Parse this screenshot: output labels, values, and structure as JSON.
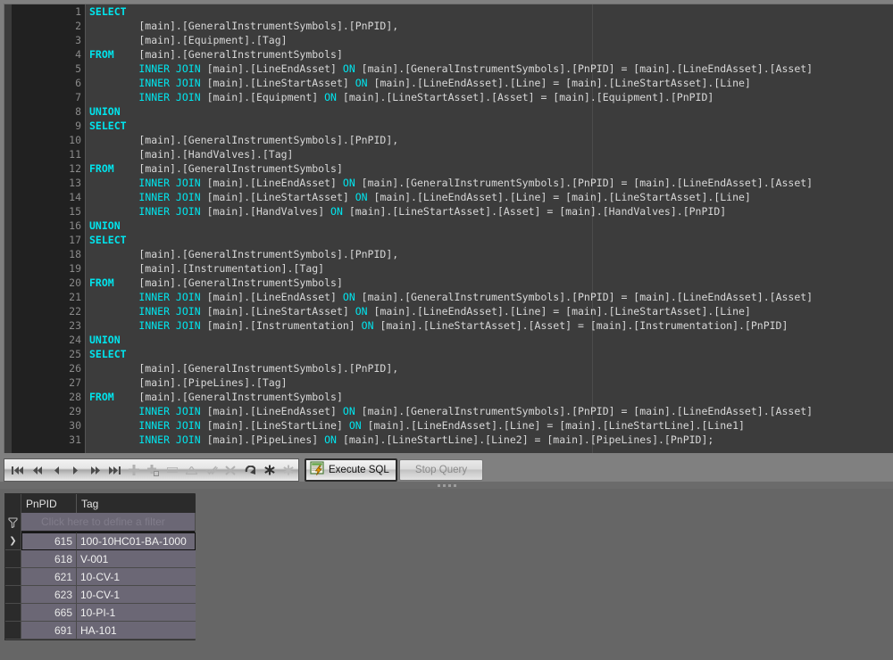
{
  "editor": {
    "name": "sql-editor",
    "lines": [
      {
        "n": "1",
        "segments": [
          {
            "t": "SELECT",
            "c": "kw"
          }
        ]
      },
      {
        "n": "2",
        "segments": [
          {
            "t": "        [main].[GeneralInstrumentSymbols].[PnPID],",
            "c": "pl"
          }
        ]
      },
      {
        "n": "3",
        "segments": [
          {
            "t": "        [main].[Equipment].[Tag]",
            "c": "pl"
          }
        ]
      },
      {
        "n": "4",
        "segments": [
          {
            "t": "FROM",
            "c": "kw"
          },
          {
            "t": "    [main].[GeneralInstrumentSymbols]",
            "c": "pl"
          }
        ]
      },
      {
        "n": "5",
        "segments": [
          {
            "t": "        ",
            "c": "pl"
          },
          {
            "t": "INNER JOIN",
            "c": "kw2"
          },
          {
            "t": " [main].[LineEndAsset] ",
            "c": "pl"
          },
          {
            "t": "ON",
            "c": "kw2"
          },
          {
            "t": " [main].[GeneralInstrumentSymbols].[PnPID] = [main].[LineEndAsset].[Asset]",
            "c": "pl"
          }
        ]
      },
      {
        "n": "6",
        "segments": [
          {
            "t": "        ",
            "c": "pl"
          },
          {
            "t": "INNER JOIN",
            "c": "kw2"
          },
          {
            "t": " [main].[LineStartAsset] ",
            "c": "pl"
          },
          {
            "t": "ON",
            "c": "kw2"
          },
          {
            "t": " [main].[LineEndAsset].[Line] = [main].[LineStartAsset].[Line]",
            "c": "pl"
          }
        ]
      },
      {
        "n": "7",
        "segments": [
          {
            "t": "        ",
            "c": "pl"
          },
          {
            "t": "INNER JOIN",
            "c": "kw2"
          },
          {
            "t": " [main].[Equipment] ",
            "c": "pl"
          },
          {
            "t": "ON",
            "c": "kw2"
          },
          {
            "t": " [main].[LineStartAsset].[Asset] = [main].[Equipment].[PnPID]",
            "c": "pl"
          }
        ]
      },
      {
        "n": "8",
        "segments": [
          {
            "t": "UNION",
            "c": "kw"
          }
        ]
      },
      {
        "n": "9",
        "segments": [
          {
            "t": "SELECT",
            "c": "kw"
          }
        ]
      },
      {
        "n": "10",
        "segments": [
          {
            "t": "        [main].[GeneralInstrumentSymbols].[PnPID],",
            "c": "pl"
          }
        ]
      },
      {
        "n": "11",
        "segments": [
          {
            "t": "        [main].[HandValves].[Tag]",
            "c": "pl"
          }
        ]
      },
      {
        "n": "12",
        "segments": [
          {
            "t": "FROM",
            "c": "kw"
          },
          {
            "t": "    [main].[GeneralInstrumentSymbols]",
            "c": "pl"
          }
        ]
      },
      {
        "n": "13",
        "segments": [
          {
            "t": "        ",
            "c": "pl"
          },
          {
            "t": "INNER JOIN",
            "c": "kw2"
          },
          {
            "t": " [main].[LineEndAsset] ",
            "c": "pl"
          },
          {
            "t": "ON",
            "c": "kw2"
          },
          {
            "t": " [main].[GeneralInstrumentSymbols].[PnPID] = [main].[LineEndAsset].[Asset]",
            "c": "pl"
          }
        ]
      },
      {
        "n": "14",
        "segments": [
          {
            "t": "        ",
            "c": "pl"
          },
          {
            "t": "INNER JOIN",
            "c": "kw2"
          },
          {
            "t": " [main].[LineStartAsset] ",
            "c": "pl"
          },
          {
            "t": "ON",
            "c": "kw2"
          },
          {
            "t": " [main].[LineEndAsset].[Line] = [main].[LineStartAsset].[Line]",
            "c": "pl"
          }
        ]
      },
      {
        "n": "15",
        "segments": [
          {
            "t": "        ",
            "c": "pl"
          },
          {
            "t": "INNER JOIN",
            "c": "kw2"
          },
          {
            "t": " [main].[HandValves] ",
            "c": "pl"
          },
          {
            "t": "ON",
            "c": "kw2"
          },
          {
            "t": " [main].[LineStartAsset].[Asset] = [main].[HandValves].[PnPID]",
            "c": "pl"
          }
        ]
      },
      {
        "n": "16",
        "segments": [
          {
            "t": "UNION",
            "c": "kw"
          }
        ]
      },
      {
        "n": "17",
        "segments": [
          {
            "t": "SELECT",
            "c": "kw"
          }
        ]
      },
      {
        "n": "18",
        "segments": [
          {
            "t": "        [main].[GeneralInstrumentSymbols].[PnPID],",
            "c": "pl"
          }
        ]
      },
      {
        "n": "19",
        "segments": [
          {
            "t": "        [main].[Instrumentation].[Tag]",
            "c": "pl"
          }
        ]
      },
      {
        "n": "20",
        "segments": [
          {
            "t": "FROM",
            "c": "kw"
          },
          {
            "t": "    [main].[GeneralInstrumentSymbols]",
            "c": "pl"
          }
        ]
      },
      {
        "n": "21",
        "segments": [
          {
            "t": "        ",
            "c": "pl"
          },
          {
            "t": "INNER JOIN",
            "c": "kw2"
          },
          {
            "t": " [main].[LineEndAsset] ",
            "c": "pl"
          },
          {
            "t": "ON",
            "c": "kw2"
          },
          {
            "t": " [main].[GeneralInstrumentSymbols].[PnPID] = [main].[LineEndAsset].[Asset]",
            "c": "pl"
          }
        ]
      },
      {
        "n": "22",
        "segments": [
          {
            "t": "        ",
            "c": "pl"
          },
          {
            "t": "INNER JOIN",
            "c": "kw2"
          },
          {
            "t": " [main].[LineStartAsset] ",
            "c": "pl"
          },
          {
            "t": "ON",
            "c": "kw2"
          },
          {
            "t": " [main].[LineEndAsset].[Line] = [main].[LineStartAsset].[Line]",
            "c": "pl"
          }
        ]
      },
      {
        "n": "23",
        "segments": [
          {
            "t": "        ",
            "c": "pl"
          },
          {
            "t": "INNER JOIN",
            "c": "kw2"
          },
          {
            "t": " [main].[Instrumentation] ",
            "c": "pl"
          },
          {
            "t": "ON",
            "c": "kw2"
          },
          {
            "t": " [main].[LineStartAsset].[Asset] = [main].[Instrumentation].[PnPID]",
            "c": "pl"
          }
        ]
      },
      {
        "n": "24",
        "segments": [
          {
            "t": "UNION",
            "c": "kw"
          }
        ]
      },
      {
        "n": "25",
        "segments": [
          {
            "t": "SELECT",
            "c": "kw"
          }
        ]
      },
      {
        "n": "26",
        "segments": [
          {
            "t": "        [main].[GeneralInstrumentSymbols].[PnPID],",
            "c": "pl"
          }
        ]
      },
      {
        "n": "27",
        "segments": [
          {
            "t": "        [main].[PipeLines].[Tag]",
            "c": "pl"
          }
        ]
      },
      {
        "n": "28",
        "segments": [
          {
            "t": "FROM",
            "c": "kw"
          },
          {
            "t": "    [main].[GeneralInstrumentSymbols]",
            "c": "pl"
          }
        ]
      },
      {
        "n": "29",
        "segments": [
          {
            "t": "        ",
            "c": "pl"
          },
          {
            "t": "INNER JOIN",
            "c": "kw2"
          },
          {
            "t": " [main].[LineEndAsset] ",
            "c": "pl"
          },
          {
            "t": "ON",
            "c": "kw2"
          },
          {
            "t": " [main].[GeneralInstrumentSymbols].[PnPID] = [main].[LineEndAsset].[Asset]",
            "c": "pl"
          }
        ]
      },
      {
        "n": "30",
        "segments": [
          {
            "t": "        ",
            "c": "pl"
          },
          {
            "t": "INNER JOIN",
            "c": "kw2"
          },
          {
            "t": " [main].[LineStartLine] ",
            "c": "pl"
          },
          {
            "t": "ON",
            "c": "kw2"
          },
          {
            "t": " [main].[LineEndAsset].[Line] = [main].[LineStartLine].[Line1]",
            "c": "pl"
          }
        ]
      },
      {
        "n": "31",
        "segments": [
          {
            "t": "        ",
            "c": "pl"
          },
          {
            "t": "INNER JOIN",
            "c": "kw2"
          },
          {
            "t": " [main].[PipeLines] ",
            "c": "pl"
          },
          {
            "t": "ON",
            "c": "kw2"
          },
          {
            "t": " [main].[LineStartLine].[Line2] = [main].[PipeLines].[PnPID];",
            "c": "pl"
          }
        ]
      }
    ]
  },
  "toolbar": {
    "nav_buttons": [
      {
        "name": "first-record-button",
        "icon": "first-record-icon"
      },
      {
        "name": "prior-page-button",
        "icon": "prior-page-icon"
      },
      {
        "name": "prior-record-button",
        "icon": "prior-record-icon"
      },
      {
        "name": "next-record-button",
        "icon": "next-record-icon"
      },
      {
        "name": "next-page-button",
        "icon": "next-page-icon"
      },
      {
        "name": "last-record-button",
        "icon": "last-record-icon"
      },
      {
        "name": "insert-record-button",
        "icon": "plus-icon"
      },
      {
        "name": "copy-record-button",
        "icon": "plus-copy-icon"
      },
      {
        "name": "delete-record-button",
        "icon": "minus-icon"
      },
      {
        "name": "edit-record-button",
        "icon": "triangle-up-icon"
      },
      {
        "name": "post-edit-button",
        "icon": "check-icon"
      },
      {
        "name": "cancel-edit-button",
        "icon": "cross-icon"
      },
      {
        "name": "refresh-button",
        "icon": "refresh-icon"
      },
      {
        "name": "apply-updates-button",
        "icon": "asterisk-icon"
      },
      {
        "name": "cancel-updates-button",
        "icon": "asterisk-disabled-icon"
      }
    ],
    "execute_label": "Execute SQL",
    "execute_icon": "execute-sql-icon",
    "stop_label": "Stop Query"
  },
  "results": {
    "name": "query-results-grid",
    "columns": [
      "PnPID",
      "Tag"
    ],
    "filter_placeholder": "Click here to define a filter",
    "filter_icon": "funnel-icon",
    "selected_row_index": 0,
    "row_indicator": "❯",
    "rows": [
      {
        "PnPID": "615",
        "Tag": "100-10HC01-BA-1000"
      },
      {
        "PnPID": "618",
        "Tag": "V-001"
      },
      {
        "PnPID": "621",
        "Tag": "10-CV-1"
      },
      {
        "PnPID": "623",
        "Tag": "10-CV-1"
      },
      {
        "PnPID": "665",
        "Tag": "10-PI-1"
      },
      {
        "PnPID": "691",
        "Tag": "HA-101"
      }
    ]
  },
  "colors": {
    "editor_bg": "#3c3c3c",
    "gutter_bg": "#212121",
    "keyword": "#00e5ee",
    "code_text": "#d8d8d8",
    "chrome_bg": "#808080",
    "grid_bg": "#6b6775",
    "grid_header_bg": "#2b2b2b",
    "panel_bg": "#666666"
  }
}
